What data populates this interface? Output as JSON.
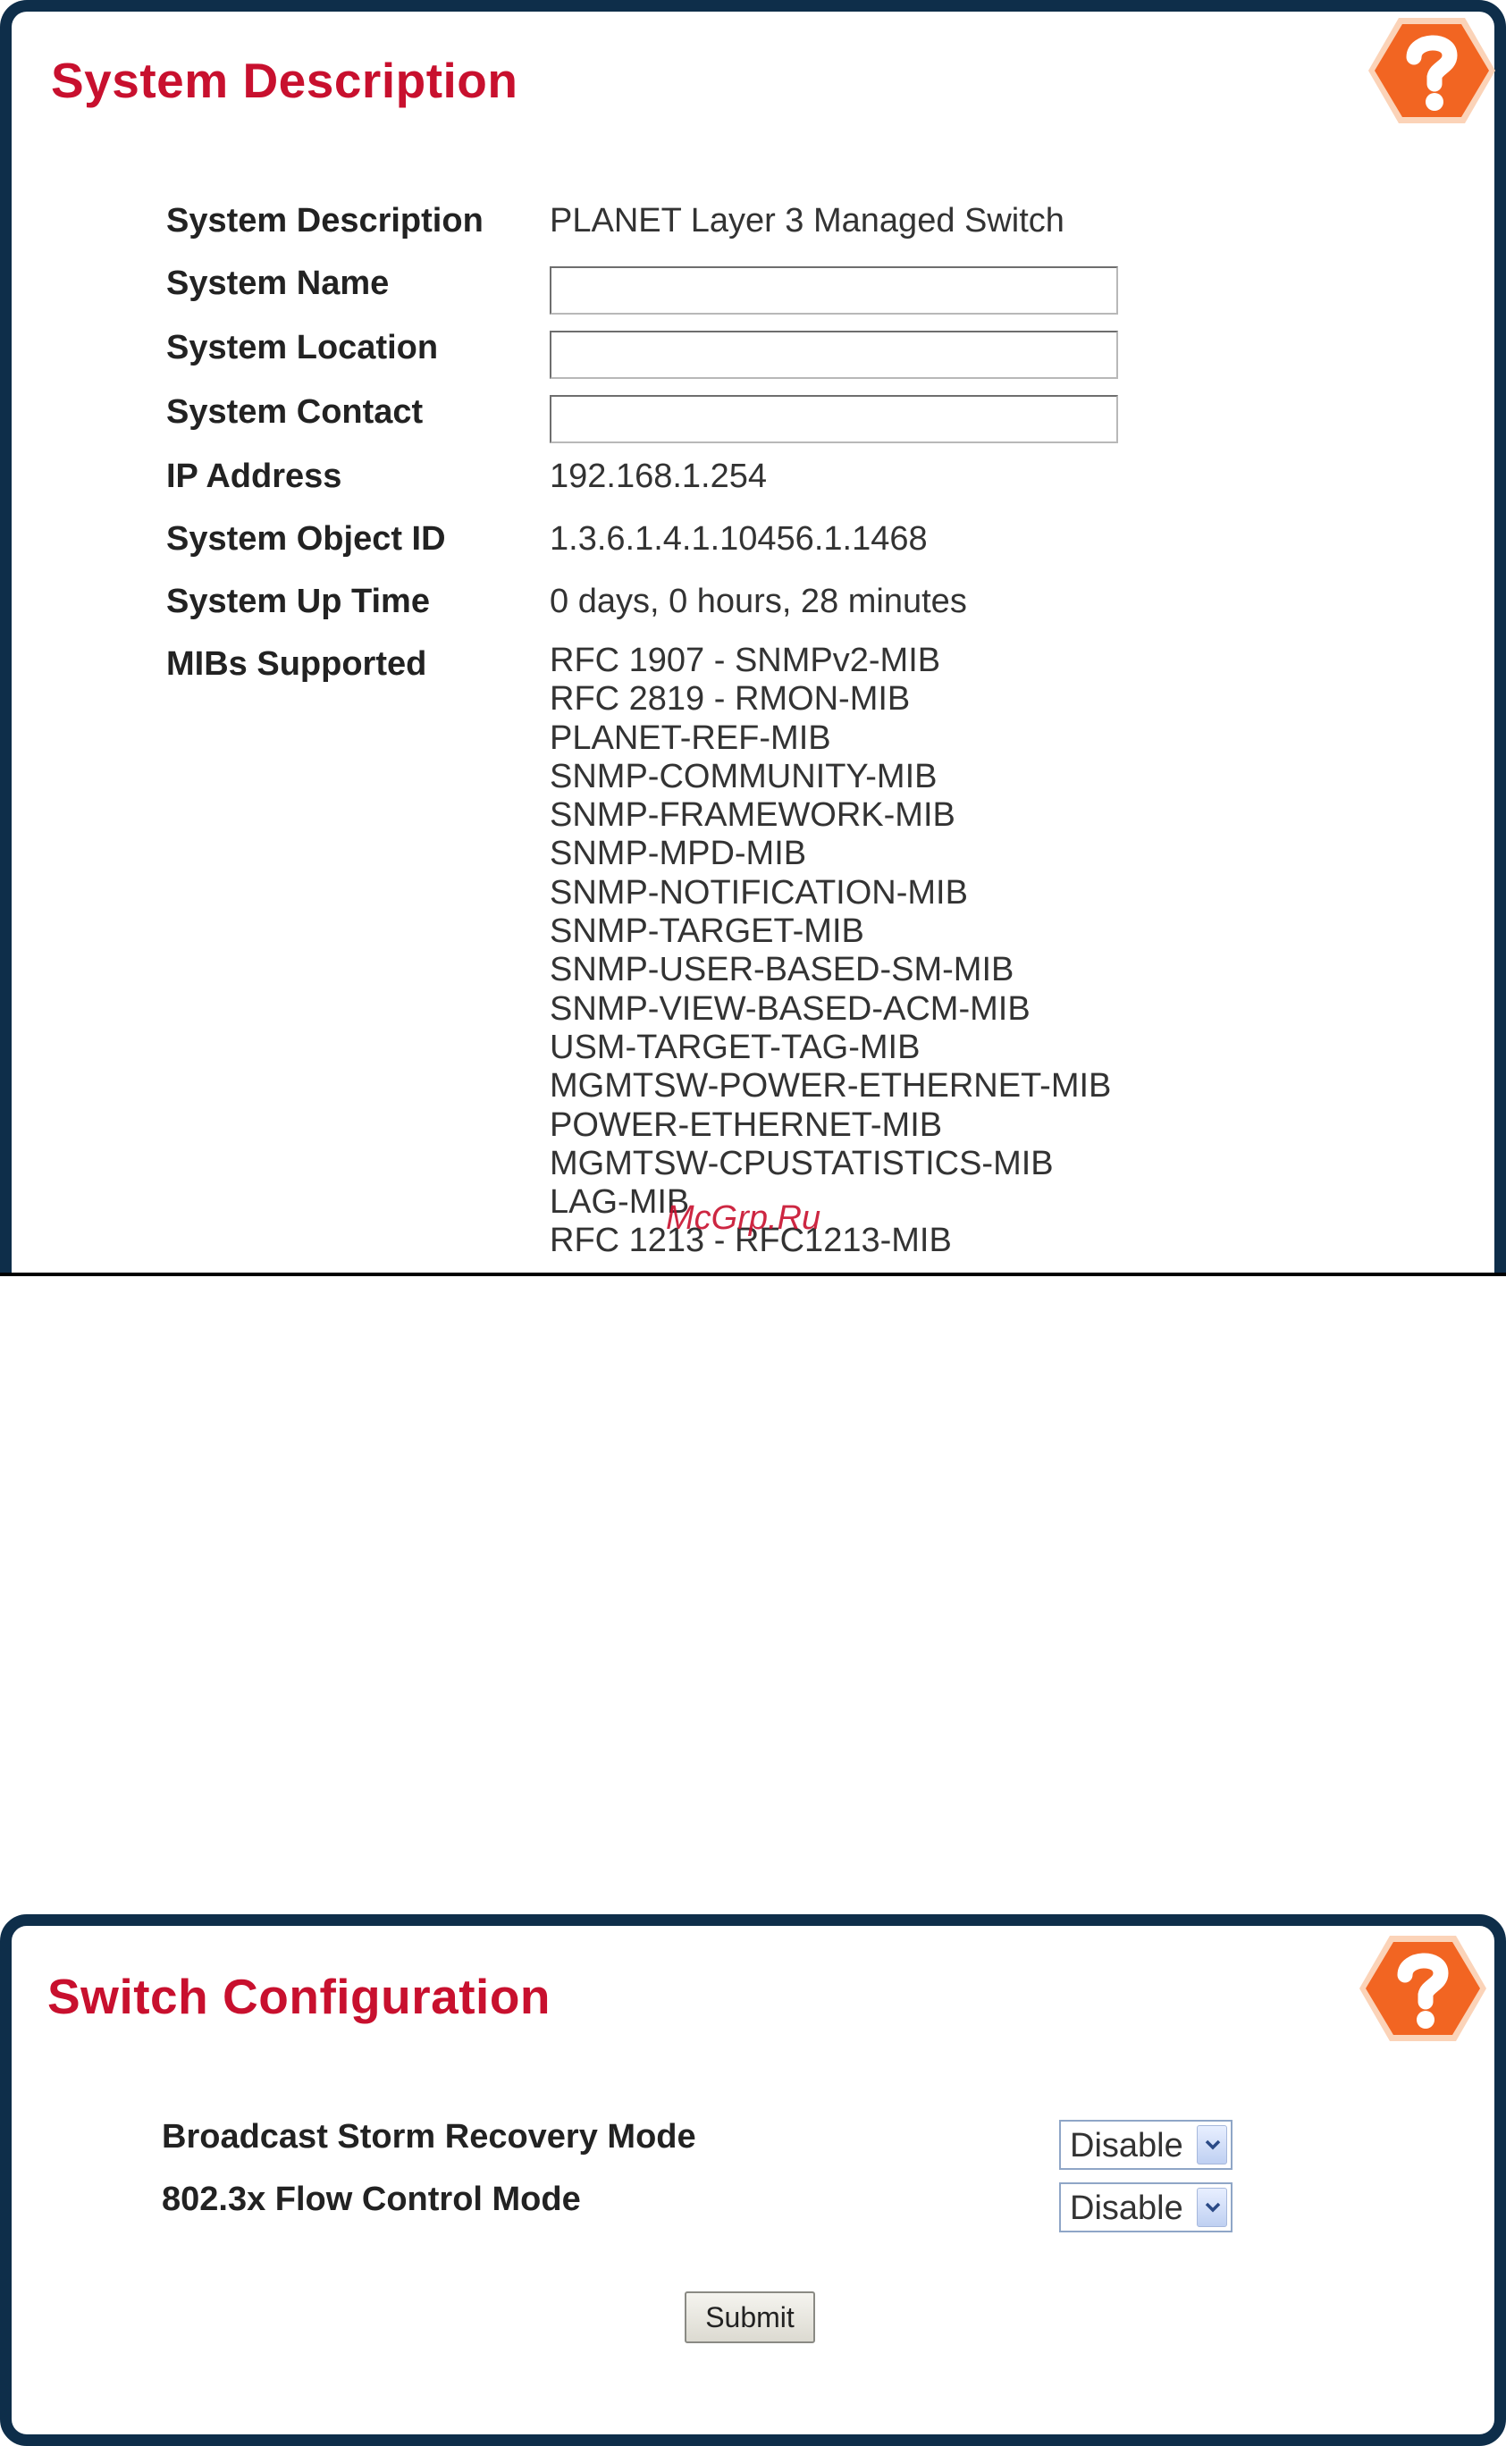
{
  "system_description": {
    "title": "System Description",
    "rows": {
      "description_label": "System Description",
      "description_value": "PLANET Layer 3 Managed Switch",
      "name_label": "System Name",
      "name_value": "",
      "location_label": "System Location",
      "location_value": "",
      "contact_label": "System Contact",
      "contact_value": "",
      "ip_label": "IP Address",
      "ip_value": "192.168.1.254",
      "object_id_label": "System Object ID",
      "object_id_value": "1.3.6.1.4.1.10456.1.1468",
      "uptime_label": "System Up Time",
      "uptime_value": "0 days, 0 hours, 28 minutes",
      "mibs_label": "MIBs Supported"
    },
    "mibs": [
      "RFC 1907 - SNMPv2-MIB",
      "RFC 2819 - RMON-MIB",
      "PLANET-REF-MIB",
      "SNMP-COMMUNITY-MIB",
      "SNMP-FRAMEWORK-MIB",
      "SNMP-MPD-MIB",
      "SNMP-NOTIFICATION-MIB",
      "SNMP-TARGET-MIB",
      "SNMP-USER-BASED-SM-MIB",
      "SNMP-VIEW-BASED-ACM-MIB",
      "USM-TARGET-TAG-MIB",
      "MGMTSW-POWER-ETHERNET-MIB",
      "POWER-ETHERNET-MIB",
      "MGMTSW-CPUSTATISTICS-MIB",
      "LAG-MIB",
      "RFC 1213 - RFC1213-MIB"
    ]
  },
  "switch_configuration": {
    "title": "Switch Configuration",
    "broadcast_label": "Broadcast Storm Recovery Mode",
    "broadcast_value": "Disable",
    "flow_label": "802.3x Flow Control Mode",
    "flow_value": "Disable",
    "submit_label": "Submit"
  },
  "watermark": "McGrp.Ru",
  "icons": {
    "help": "help-icon",
    "dropdown": "chevron-down-icon"
  },
  "colors": {
    "title": "#c8102e",
    "frame": "#0e2e4a",
    "help_orange": "#f26522"
  }
}
